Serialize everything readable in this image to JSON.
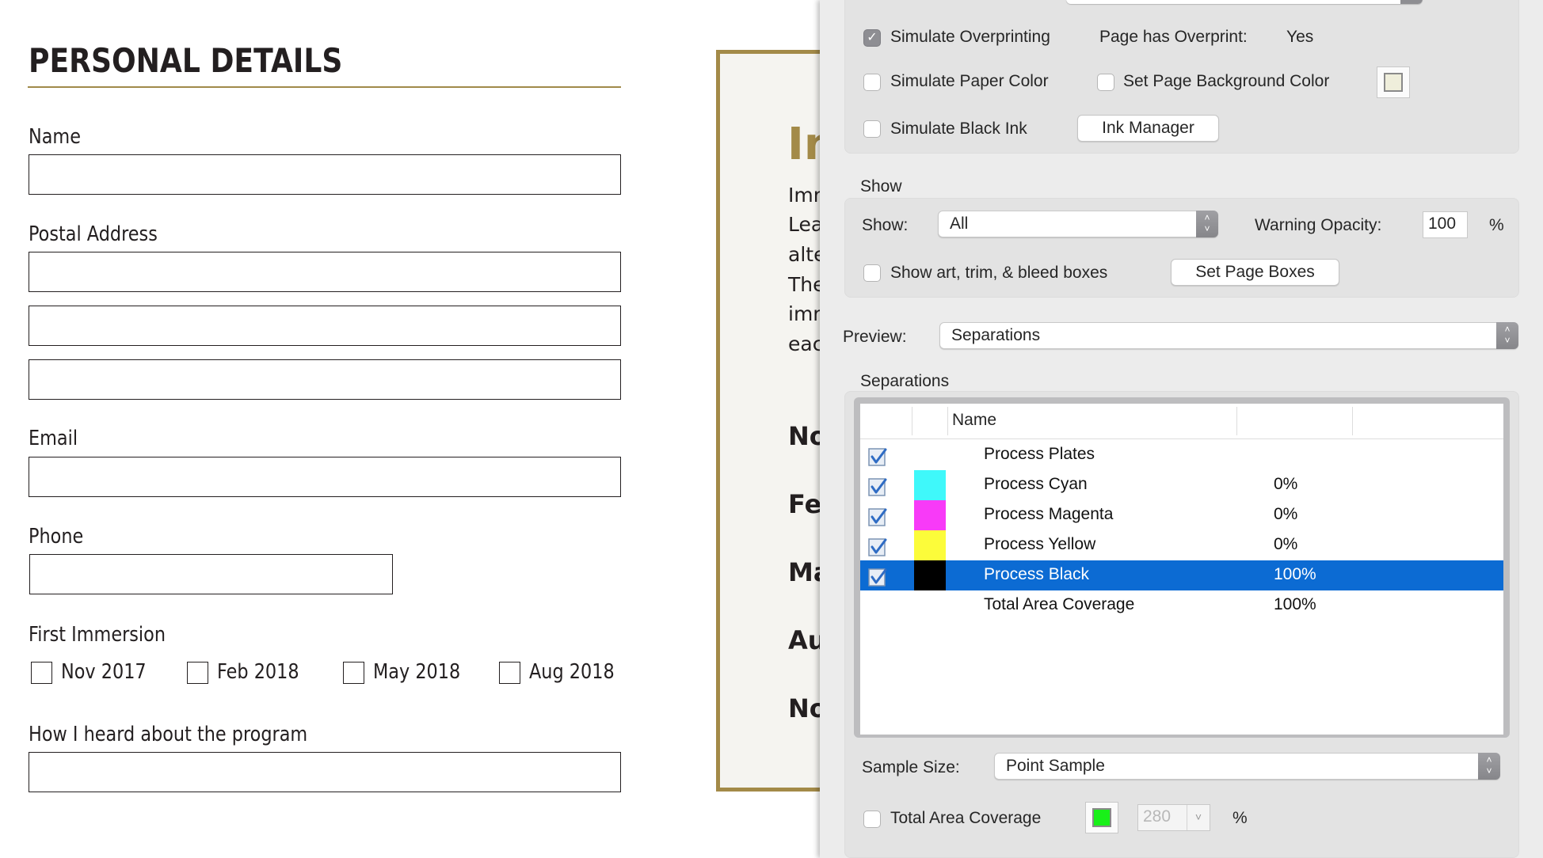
{
  "form": {
    "title": "PERSONAL DETAILS",
    "fields": {
      "name_label": "Name",
      "postal_label": "Postal Address",
      "email_label": "Email",
      "phone_label": "Phone",
      "immersion_label": "First Immersion",
      "heard_label": "How I heard about the program"
    },
    "immersion_options": [
      "Nov 2017",
      "Feb 2018",
      "May 2018",
      "Aug 2018"
    ]
  },
  "document": {
    "heading": "In",
    "lines": [
      "Imr",
      "Lea",
      "alte",
      "The",
      "imr",
      "eac"
    ],
    "dates": [
      "No",
      "Fel",
      "Ma",
      "Au",
      "No"
    ]
  },
  "panel": {
    "simulate_overprinting": {
      "label": "Simulate Overprinting",
      "checked": true
    },
    "page_has_overprint_label": "Page has Overprint:",
    "page_has_overprint_value": "Yes",
    "simulate_paper_color": {
      "label": "Simulate Paper Color",
      "checked": false
    },
    "set_page_bg": {
      "label": "Set Page Background Color",
      "checked": false
    },
    "page_bg_color": "#efeedb",
    "simulate_black_ink": {
      "label": "Simulate Black Ink",
      "checked": false
    },
    "ink_manager_button": "Ink Manager",
    "show_section_title": "Show",
    "show_label": "Show:",
    "show_value": "All",
    "warning_opacity_label": "Warning Opacity:",
    "warning_opacity_value": "100",
    "percent": "%",
    "show_boxes": {
      "label": "Show art, trim, & bleed boxes",
      "checked": false
    },
    "set_page_boxes_button": "Set Page Boxes",
    "preview_label": "Preview:",
    "preview_value": "Separations",
    "separations_title": "Separations",
    "table": {
      "name_header": "Name",
      "rows": [
        {
          "name": "Process Plates",
          "coverage": "",
          "checked": true,
          "swatch": null,
          "selected": false
        },
        {
          "name": "Process Cyan",
          "coverage": "0%",
          "checked": true,
          "swatch": "#3ff8fa",
          "selected": false
        },
        {
          "name": "Process Magenta",
          "coverage": "0%",
          "checked": true,
          "swatch": "#f83af8",
          "selected": false
        },
        {
          "name": "Process Yellow",
          "coverage": "0%",
          "checked": true,
          "swatch": "#fcfc3a",
          "selected": false
        },
        {
          "name": "Process Black",
          "coverage": "100%",
          "checked": true,
          "swatch": "#000000",
          "selected": true
        },
        {
          "name": "Total Area Coverage",
          "coverage": "100%",
          "checked": null,
          "swatch": null,
          "selected": false
        }
      ]
    },
    "sample_size_label": "Sample Size:",
    "sample_size_value": "Point Sample",
    "total_area_coverage": {
      "label": "Total Area Coverage",
      "checked": false
    },
    "tac_color": "#19f019",
    "tac_value": "280",
    "tac_percent": "%"
  },
  "colors": {
    "accent_gold": "#a38a48",
    "selection_blue": "#0c6bd3"
  }
}
